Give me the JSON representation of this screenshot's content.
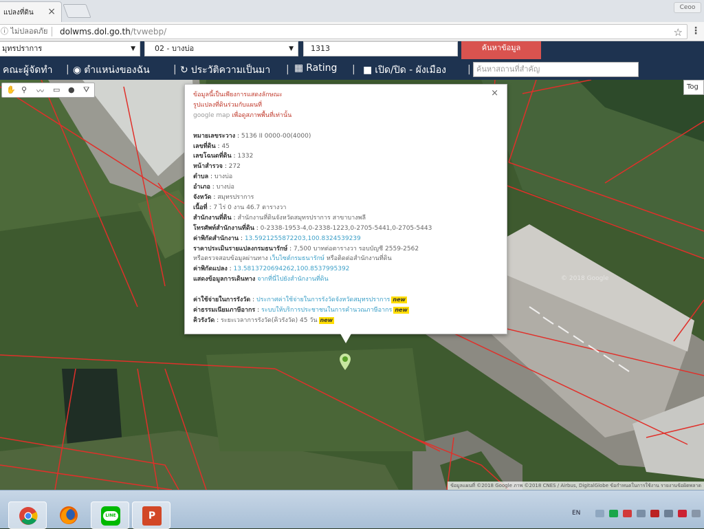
{
  "browser": {
    "tab_title": "แปลงที่ดิน",
    "tab_close": "×",
    "user_button": "Ceoo",
    "security_label": "ไม่ปลอดภัย",
    "url_host": "dolwms.dol.go.th",
    "url_path": "/tvwebp/",
    "star_icon": "☆",
    "menu_icon": "⋮"
  },
  "header": {
    "province_select": "มุทรปราการ",
    "district_select": "02 - บางบ่อ",
    "parcel_input": "1313",
    "search_button": "ค้นหาข้อมูล"
  },
  "toolbar": {
    "items": [
      {
        "icon": "👤",
        "label": "คณะผู้จัดทำ"
      },
      {
        "icon": "◉",
        "label": "ตำแหน่งของฉัน"
      },
      {
        "icon": "↻",
        "label": "ประวัติความเป็นมา"
      },
      {
        "icon": "▦",
        "label": "Rating"
      },
      {
        "icon": "■",
        "label": "เปิด/ปิด - ผังเมือง"
      }
    ],
    "place_search_placeholder": "ค้นหาสถานที่สำคัญ"
  },
  "map": {
    "toggle_label": "Tog",
    "watermark": "© 2018 Google",
    "attribution": "ข้อมูลแผนที่ ©2018 Google ภาพ ©2018 CNES / Airbus, DigitalGlobe   ข้อกำหนดในการใช้งาน   รายงานข้อผิดพลาด"
  },
  "popup": {
    "close": "×",
    "warning": [
      "ข้อมูลนี้เป็นเพียงการแสดงลักษณะ",
      "รูปแปลงที่ดินร่วมกับแผนที่"
    ],
    "warning3_prefix": "google map",
    "warning3_suffix": " เพื่อดูสภาพพื้นที่เท่านั้น",
    "fields": [
      {
        "label": "หมายเลขระวาง",
        "value": "5136 II 0000-00(4000)"
      },
      {
        "label": "เลขที่ดิน",
        "value": "45"
      },
      {
        "label": "เลขโฉนดที่ดิน",
        "value": "1332"
      },
      {
        "label": "หน้าสำรวจ",
        "value": "272"
      },
      {
        "label": "ตำบล",
        "value": "บางบ่อ"
      },
      {
        "label": "อำเภอ",
        "value": "บางบ่อ"
      },
      {
        "label": "จังหวัด",
        "value": "สมุทรปราการ"
      },
      {
        "label": "เนื้อที่",
        "value": "7 ไร่ 0 งาน 46.7 ตารางวา"
      },
      {
        "label": "สำนักงานที่ดิน",
        "value": "สำนักงานที่ดินจังหวัดสมุทรปราการ สาขาบางพลี"
      },
      {
        "label": "โทรศัพท์สำนักงานที่ดิน",
        "value": "0-2338-1953-4,0-2338-1223,0-2705-5441,0-2705-5443"
      }
    ],
    "office_coord_label": "ค่าพิกัดสำนักงาน",
    "office_coord_value": "13.5921255872203,100.8324539239",
    "price_label": "ราคาประเมินรายแปลงกรมธนารักษ์",
    "price_value": "7,500 บาทต่อตารางวา รอบบัญชี 2559-2562",
    "check_prefix": "หรือตรวจสอบข้อมูลผ่านทาง ",
    "check_link": "เว็บไซต์กรมธนารักษ์",
    "check_suffix": " หรือติดต่อสำนักงานที่ดิน",
    "parcel_coord_label": "ค่าพิกัดแปลง",
    "parcel_coord_value": "13.5813720694262,100.8537995392",
    "route_label": "แสดงข้อมูลการเดินทาง",
    "route_link": "จากที่นี่ไปยังสำนักงานที่ดิน",
    "fee_label": "ค่าใช้จ่ายในการรังวัด",
    "fee_link": "ประกาศค่าใช้จ่ายในการรังวัดจังหวัดสมุทรปราการ",
    "reg_label": "ค่าธรรมเนียมภาษีอากร",
    "reg_link": "ระบบให้บริการประชาชนในการคำนวณภาษีอากร",
    "queue_label": "คิวรังวัด",
    "queue_value": "ระยะเวลาการรังวัด(คิวรังวัด) 45 วัน",
    "new_badge": "new"
  },
  "taskbar": {
    "apps": [
      "chrome-icon",
      "firefox-icon",
      "line-icon",
      "powerpoint-icon"
    ],
    "lang": "EN"
  },
  "colors": {
    "header_bg": "#1e3350",
    "search_red": "#d9534f",
    "parcel_line": "#e0302a",
    "warning_red": "#c0392b",
    "link_blue": "#3da0c8"
  }
}
